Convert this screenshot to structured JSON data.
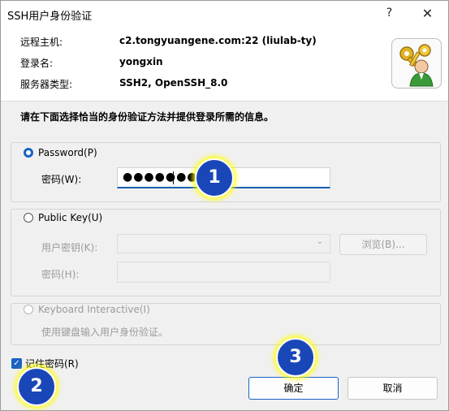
{
  "window": {
    "title": "SSH用户身份验证",
    "help_icon": "?",
    "close_icon": "✕"
  },
  "header": {
    "host_label": "远程主机:",
    "host_value": "c2.tongyuangene.com:22 (liulab-ty)",
    "login_label": "登录名:",
    "login_value": "yongxin",
    "server_type_label": "服务器类型:",
    "server_type_value": "SSH2, OpenSSH_8.0",
    "logo_icon": "keys-user-icon"
  },
  "instruction": "请在下面选择恰当的身份验证方法并提供登录所需的信息。",
  "password_group": {
    "radio_label": "Password(P)",
    "selected": true,
    "field_label": "密码(W):",
    "value": "●●●●●●●●"
  },
  "publickey_group": {
    "radio_label": "Public Key(U)",
    "selected": false,
    "key_label": "用户密钥(K):",
    "key_value": "",
    "browse_label": "浏览(B)...",
    "passphrase_label": "密码(H):"
  },
  "keyboard_group": {
    "radio_label": "Keyboard Interactive(I)",
    "selected": false,
    "description": "使用键盘输入用户身份验证。"
  },
  "remember": {
    "label": "记住密码(R)",
    "checked": true
  },
  "buttons": {
    "ok": "确定",
    "cancel": "取消"
  },
  "annotations": {
    "badge1": "1",
    "badge2": "2",
    "badge3": "3"
  },
  "colors": {
    "accent": "#1b62c2",
    "badge": "#1a47b8",
    "badge_glow": "#ffff00"
  }
}
